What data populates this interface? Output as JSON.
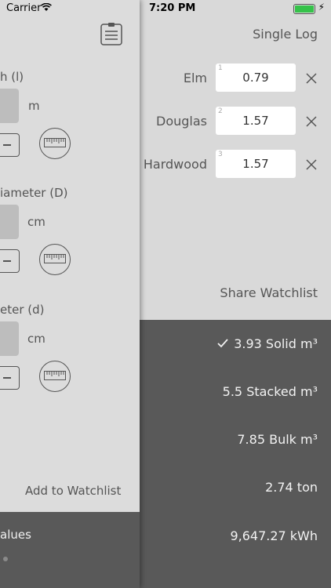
{
  "status_bar": {
    "carrier": "Carrier",
    "time": "7:20 PM"
  },
  "drawer": {
    "length_label": "h (l)",
    "length_unit": "m",
    "diameter_label": "iameter (D)",
    "diameter_unit": "cm",
    "small_diameter_label": "eter (d)",
    "small_diameter_unit": "cm",
    "add_to_watchlist": "Add to Watchlist",
    "footer_label": "alues"
  },
  "header": {
    "title": "Single Log"
  },
  "logs": [
    {
      "index": "1",
      "name": "Elm",
      "value": "0.79"
    },
    {
      "index": "2",
      "name": "Douglas",
      "value": "1.57"
    },
    {
      "index": "3",
      "name": "Hardwood",
      "value": "1.57"
    }
  ],
  "share_label": "Share Watchlist",
  "results": [
    {
      "text": "3.93 Solid m³",
      "selected": true
    },
    {
      "text": "5.5 Stacked m³",
      "selected": false
    },
    {
      "text": "7.85 Bulk m³",
      "selected": false
    },
    {
      "text": "2.74 ton",
      "selected": false
    },
    {
      "text": "9,647.27 kWh",
      "selected": false
    }
  ],
  "colors": {
    "background": "#d9d9d9",
    "results_bg": "#595959",
    "field_bg": "#ffffff",
    "battery": "#35c24a"
  }
}
